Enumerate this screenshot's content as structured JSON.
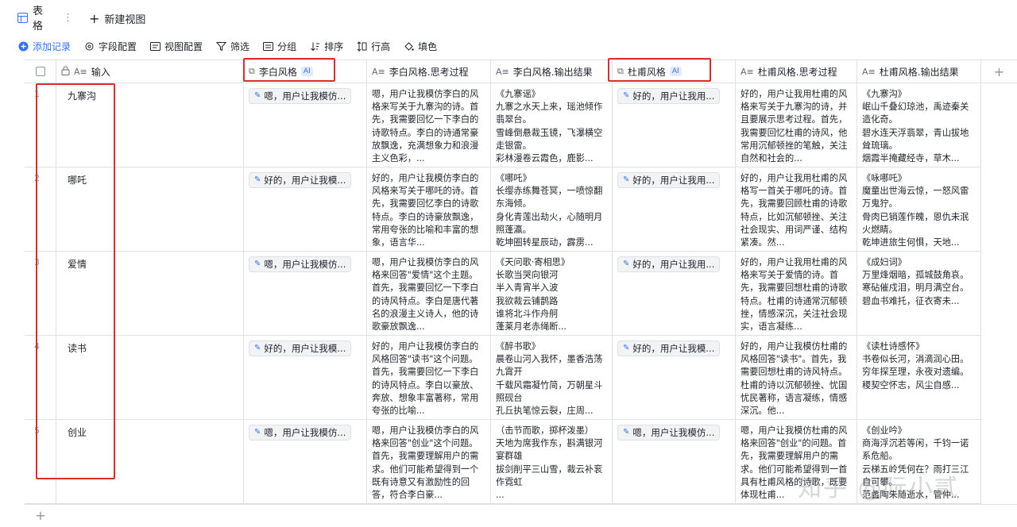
{
  "view_tabs": {
    "table_label": "表格",
    "more": "⋮",
    "new_view": "新建视图"
  },
  "toolbar": {
    "add_record": "添加记录",
    "field_config": "字段配置",
    "view_config": "视图配置",
    "filter": "筛选",
    "group": "分组",
    "sort": "排序",
    "row_height": "行高",
    "fill": "填色"
  },
  "columns": {
    "input": "输入",
    "libai_style": "李白风格",
    "libai_think": "李白风格.思考过程",
    "libai_output": "李白风格.输出结果",
    "dufu_style": "杜甫风格",
    "dufu_think": "杜甫风格.思考过程",
    "dufu_output": "杜甫风格.输出结果",
    "ai_badge": "AI"
  },
  "rows": [
    {
      "num": "1",
      "input": "九寨沟",
      "libai_chip": "嗯，用户让我模仿...",
      "libai_think": "嗯，用户让我模仿李白的风格来写关于九寨沟的诗。首先，我需要回忆一下李白的诗歌特点。李白的诗通常豪放飘逸，充满想象力和浪漫主义色彩，...",
      "libai_output": "《九寨谣》\n九寨之水天上来，瑶池倾作翡翠台。\n雪峰倒悬裁玉镜，飞瀑横空走银雷。\n彩林漫卷云霞色，鹿影...",
      "dufu_chip": "好的，用户让我用...",
      "dufu_think": "好的，用户让我用杜甫的风格来写关于九寨沟的诗，并且要展示思考过程。首先，我需要回忆杜甫的诗风，他常用沉郁顿挫的笔触，关注自然和社会的...",
      "dufu_output": "《九寨沟》\n岷山千叠幻琼池，禹迹秦关造化奇。\n碧水连天浮翡翠，青山拔地耸琉璃。\n烟霞半掩藏经寺，草木..."
    },
    {
      "num": "2",
      "input": "哪吒",
      "libai_chip": "好的，用户让我模...",
      "libai_think": "好的，用户让我模仿李白的风格来写关于哪吒的诗。首先，我需要回忆李白的诗歌特点。李白的诗豪放飘逸，常用夸张的比喻和丰富的想象，语言华...",
      "libai_output": "《哪吒》\n长缨赤练舞苍冥，一喷惊翻东海倾。\n身化青莲出劫火，心随明月照蓬瀛。\n乾坤圈转星辰动，霹雳...",
      "dufu_chip": "好的，用户让我用...",
      "dufu_think": "好的，用户让我用杜甫的风格写一首关于哪吒的诗。首先，我需要回顾杜甫的诗歌特点，比如沉郁顿挫、关注社会现实、用词严谨、结构紧凑。然...",
      "dufu_output": "《咏哪吒》\n魔童出世海云惊，一怒风雷万鬼狞。\n骨肉已销莲作魄，恩仇未泯火燃睛。\n乾坤进旅生何惧，天地..."
    },
    {
      "num": "3",
      "input": "爱情",
      "libai_chip": "嗯，用户让我模仿...",
      "libai_think": "嗯，用户让我模仿李白的风格来回答\"爱情\"这个主题。首先，我需要回忆一下李白的诗风特点。李白是唐代著名的浪漫主义诗人，他的诗歌豪放飘逸...",
      "libai_output": "《天问歌·寄相思》\n长歌当哭向银河\n半入青宵半入波\n我欲裁云铺鹊路\n谁将北斗作舟舸\n蓬莱月老赤绳断...",
      "dufu_chip": "好的，用户让我用...",
      "dufu_think": "好的，用户让我用杜甫的风格来写关于爱情的诗。首先，我需要回想杜甫的诗歌特点。杜甫的诗通常沉郁顿挫，情感深沉，关注社会现实，语言凝练...",
      "dufu_output": "《成妇词》\n万里烽烟暗，孤城鼓角哀。\n寒砧催戍泪，明月满空台。\n碧血书难托，征衣寄未..."
    },
    {
      "num": "4",
      "input": "读书",
      "libai_chip": "好的，用户让我模...",
      "libai_think": "好的，用户让我模仿李白的风格回答\"读书\"这个问题。首先，我需要回忆一下李白的诗风特点。李白以豪放、奔放、想象丰富著称，常用夸张的比喻...",
      "libai_output": "《醉书歌》\n晨卷山河入我怀，墨香浩荡九霄开\n千载风霜凝竹简，万朝星斗照砚台\n孔丘执笔惊云裂，庄周...",
      "dufu_chip": "好的，用户让我模...",
      "dufu_think": "好的，用户让我模仿杜甫的风格回答\"读书\"。首先，我需要回想杜甫的诗风特点。杜甫的诗以沉郁顿挫、忧国忧民著称，语言凝练，情感深沉。他...",
      "dufu_output": "《读杜诗感怀》\n书卷似长河，涓滴润心田。\n穷年探至理，永夜对遗编。\n稷契空怀志，风尘自感..."
    },
    {
      "num": "5",
      "input": "创业",
      "libai_chip": "嗯，用户让我模仿...",
      "libai_think": "嗯，用户让我模仿李白的风格来回答\"创业\"这个问题。首先，我需要理解用户的需求。他们可能希望得到一个既有诗意又有激励性的回答，符合李白豪...",
      "libai_output": "（击节而歌，掷杯泼墨）\n天地为席我作东，斟满银河宴群雄\n拔剑削平三山雪，裁云补衮作霓虹\n...",
      "dufu_chip": "嗯，用户让我模仿...",
      "dufu_think": "嗯，用户让我模仿杜甫的风格来回答\"创业\"的问题。首先，我需要理解用户的需求。他们可能希望得到一首具有杜甫风格的诗歌，既要体现杜甫...",
      "dufu_output": "《创业吟》\n商海浮沉若等闲，千钧一诺系危船。\n云梯五岭凭何在？雨打三江自可攀。\n范蠡陶朱随逝水，管仲..."
    }
  ],
  "watermark": "知乎 @阮小贰",
  "colors": {
    "accent": "#3370ff",
    "highlight": "#e02b2b",
    "border": "#dee0e3"
  }
}
